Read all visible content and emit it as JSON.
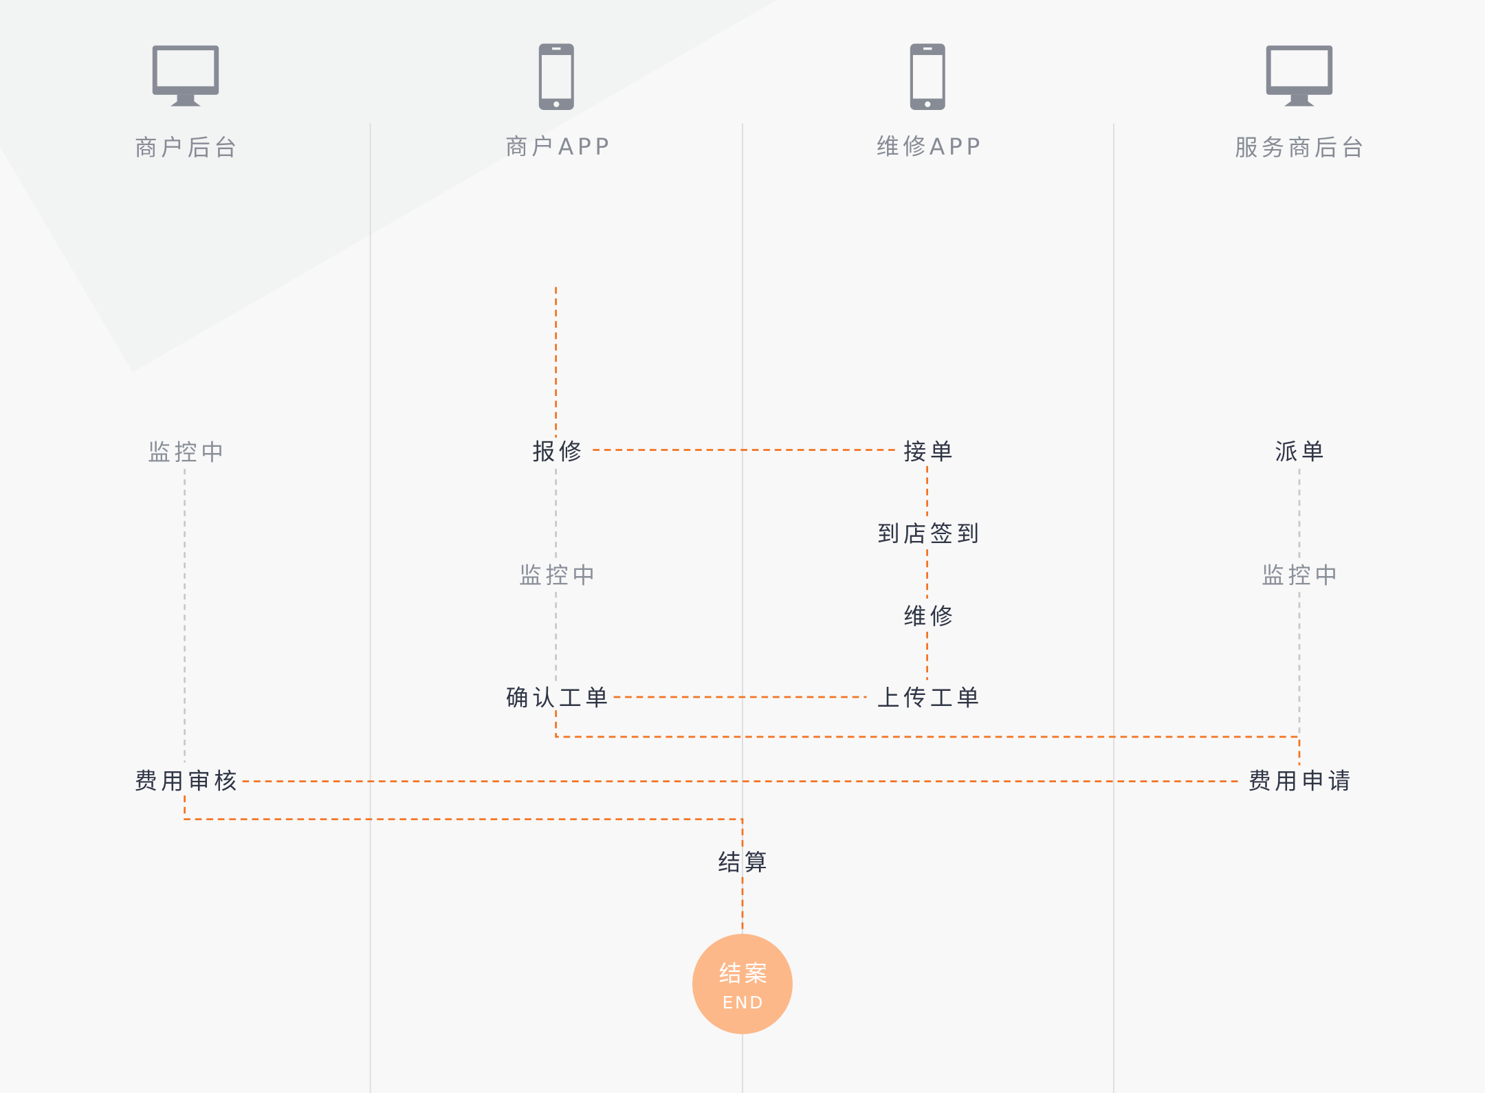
{
  "colors": {
    "flow_line": "#f47321",
    "monitor_line": "#c6c8cc",
    "end_circle": "#fdb88a",
    "icon": "#868b95"
  },
  "lanes": [
    {
      "title": "商户后台",
      "icon": "monitor-icon"
    },
    {
      "title": "商户APP",
      "icon": "phone-icon"
    },
    {
      "title": "维修APP",
      "icon": "phone-icon"
    },
    {
      "title": "服务商后台",
      "icon": "monitor-icon"
    }
  ],
  "steps": {
    "merchant_backend_monitor": "监控中",
    "repair_request": "报修",
    "merchant_app_monitor": "监控中",
    "confirm_order": "确认工单",
    "accept_order": "接单",
    "check_in": "到店签到",
    "repair": "维修",
    "upload_order": "上传工单",
    "dispatch": "派单",
    "provider_monitor": "监控中",
    "fee_request": "费用申请",
    "fee_review": "费用审核",
    "settlement": "结算"
  },
  "end": {
    "label": "结案",
    "sublabel": "END"
  }
}
